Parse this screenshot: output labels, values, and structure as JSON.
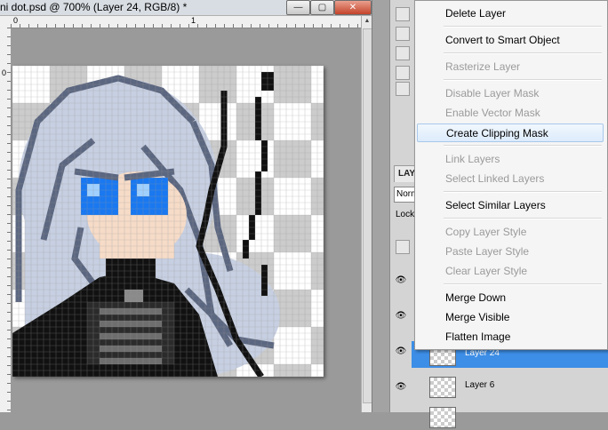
{
  "document": {
    "title": "ni dot.psd @ 700% (Layer 24, RGB/8) *"
  },
  "window_controls": {
    "minimize": "—",
    "restore": "▢",
    "close": "✕"
  },
  "rulers": {
    "h_labels": [
      "0",
      "1"
    ],
    "v_labels": [
      "0"
    ]
  },
  "layers_panel": {
    "tab": "LAYE",
    "blend_mode": "Normal",
    "lock_label": "Lock",
    "layers": [
      {
        "name": "Layer 24",
        "selected": true
      },
      {
        "name": "Layer 6",
        "selected": false
      }
    ]
  },
  "context_menu": {
    "items": [
      {
        "label": "Delete Layer",
        "enabled": true
      },
      {
        "label": "Convert to Smart Object",
        "enabled": true
      },
      {
        "label": "Rasterize Layer",
        "enabled": false
      },
      {
        "label": "Disable Layer Mask",
        "enabled": false
      },
      {
        "label": "Enable Vector Mask",
        "enabled": false
      },
      {
        "label": "Create Clipping Mask",
        "enabled": true,
        "highlighted": true
      },
      {
        "label": "Link Layers",
        "enabled": false
      },
      {
        "label": "Select Linked Layers",
        "enabled": false
      },
      {
        "label": "Select Similar Layers",
        "enabled": true
      },
      {
        "label": "Copy Layer Style",
        "enabled": false
      },
      {
        "label": "Paste Layer Style",
        "enabled": false
      },
      {
        "label": "Clear Layer Style",
        "enabled": false
      },
      {
        "label": "Merge Down",
        "enabled": true
      },
      {
        "label": "Merge Visible",
        "enabled": true
      },
      {
        "label": "Flatten Image",
        "enabled": true
      }
    ]
  },
  "colors": {
    "selection_blue": "#3d8ee6",
    "hair": "#c7d0e2",
    "hair_dark": "#5b6680",
    "skin": "#f6dcc8",
    "eye_blue": "#1a78f0",
    "outline": "#111111",
    "checker_light": "#ffffff",
    "checker_dark": "#cccccc"
  }
}
